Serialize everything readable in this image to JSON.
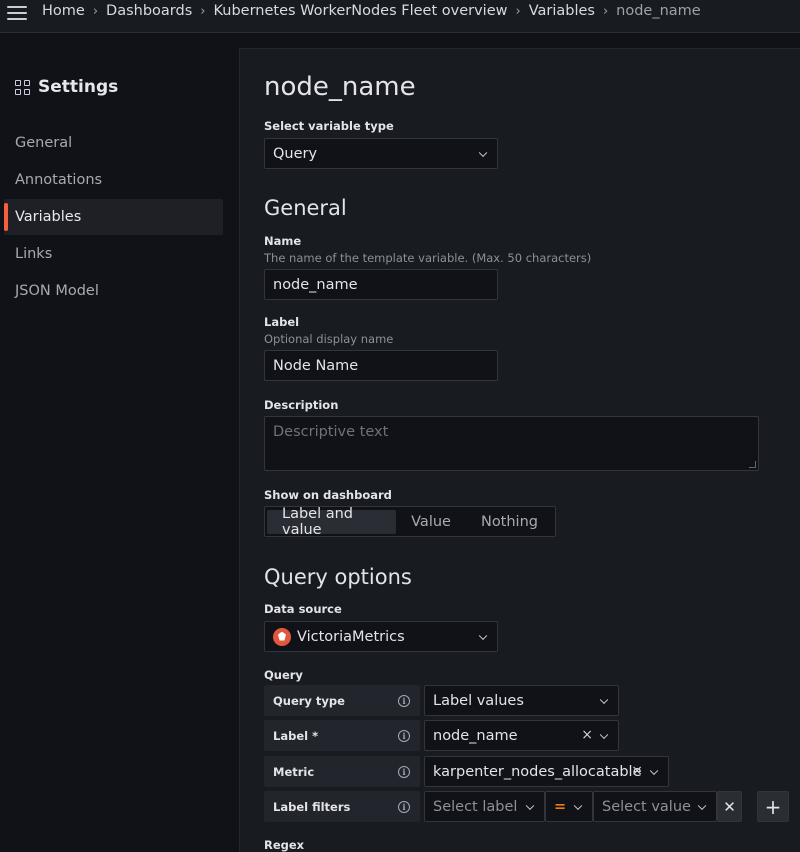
{
  "breadcrumb": [
    "Home",
    "Dashboards",
    "Kubernetes WorkerNodes Fleet overview",
    "Variables",
    "node_name"
  ],
  "sidebar": {
    "title": "Settings",
    "items": [
      {
        "label": "General"
      },
      {
        "label": "Annotations"
      },
      {
        "label": "Variables",
        "active": true
      },
      {
        "label": "Links"
      },
      {
        "label": "JSON Model"
      }
    ]
  },
  "main": {
    "title": "node_name",
    "variable_type": {
      "label": "Select variable type",
      "value": "Query"
    },
    "general": {
      "heading": "General",
      "name": {
        "label": "Name",
        "description": "The name of the template variable. (Max. 50 characters)",
        "value": "node_name"
      },
      "label": {
        "label": "Label",
        "description": "Optional display name",
        "value": "Node Name"
      },
      "description": {
        "label": "Description",
        "placeholder": "Descriptive text"
      },
      "show_on_dashboard": {
        "label": "Show on dashboard",
        "options": [
          "Label and value",
          "Value",
          "Nothing"
        ],
        "selected": "Label and value"
      }
    },
    "query_options": {
      "heading": "Query options",
      "data_source": {
        "label": "Data source",
        "value": "VictoriaMetrics"
      },
      "query_label": "Query",
      "rows": {
        "query_type": {
          "label": "Query type",
          "value": "Label values"
        },
        "label": {
          "label": "Label *",
          "value": "node_name"
        },
        "metric": {
          "label": "Metric",
          "value": "karpenter_nodes_allocatable"
        },
        "label_filters": {
          "label": "Label filters",
          "label_placeholder": "Select label",
          "operator": "=",
          "value_placeholder": "Select value"
        }
      },
      "regex_label": "Regex"
    }
  },
  "colors": {
    "accent": "#f55f3e",
    "operator": "#eb7b18",
    "datasource_icon": "#e2583e"
  }
}
